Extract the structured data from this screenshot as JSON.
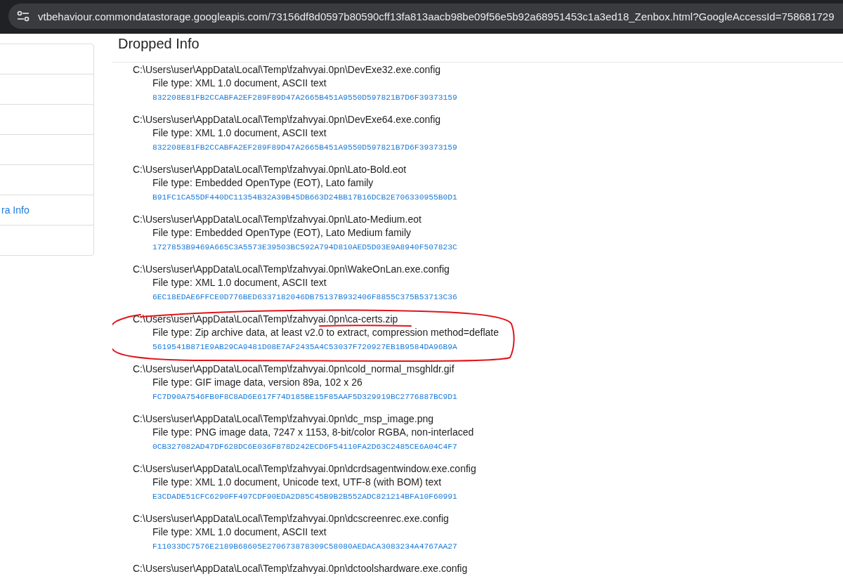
{
  "address_bar": {
    "url": "vtbehaviour.commondatastorage.googleapis.com/73156df8d0597b80590cff13fa813aacb98be09f56e5b92a68951453c1a3ed18_Zenbox.html?GoogleAccessId=758681729"
  },
  "sidebar": {
    "items": [
      {
        "kind": "blank"
      },
      {
        "kind": "blank"
      },
      {
        "kind": "blank"
      },
      {
        "kind": "blank"
      },
      {
        "kind": "blank"
      },
      {
        "kind": "link",
        "label": "ra Info"
      },
      {
        "kind": "blank"
      }
    ]
  },
  "section": {
    "title": "Dropped Info",
    "files": [
      {
        "path": "C:\\Users\\user\\AppData\\Local\\Temp\\fzahvyai.0pn\\DevExe32.exe.config",
        "file_type": "File type: XML 1.0 document, ASCII text",
        "hash": "832208E81FB2CCABFA2EF289F89D47A2665B451A9550D597821B7D6F39373159"
      },
      {
        "path": "C:\\Users\\user\\AppData\\Local\\Temp\\fzahvyai.0pn\\DevExe64.exe.config",
        "file_type": "File type: XML 1.0 document, ASCII text",
        "hash": "832208E81FB2CCABFA2EF289F89D47A2665B451A9550D597821B7D6F39373159"
      },
      {
        "path": "C:\\Users\\user\\AppData\\Local\\Temp\\fzahvyai.0pn\\Lato-Bold.eot",
        "file_type": "File type: Embedded OpenType (EOT), Lato family",
        "hash": "B91FC1CA55DF440DC11354B32A39B45DB663D24BB17B16DCB2E706330955B0D1"
      },
      {
        "path": "C:\\Users\\user\\AppData\\Local\\Temp\\fzahvyai.0pn\\Lato-Medium.eot",
        "file_type": "File type: Embedded OpenType (EOT), Lato Medium family",
        "hash": "1727853B9469A665C3A5573E39503BC592A794D810AED5D03E9A8940F507823C"
      },
      {
        "path": "C:\\Users\\user\\AppData\\Local\\Temp\\fzahvyai.0pn\\WakeOnLan.exe.config",
        "file_type": "File type: XML 1.0 document, ASCII text",
        "hash": "6EC18EDAE6FFCE0D776BED6337182046DB75137B932406F8855C375B53713C36"
      },
      {
        "path": "C:\\Users\\user\\AppData\\Local\\Temp\\fzahvyai.0pn\\ca-certs.zip",
        "file_type": "File type: Zip archive data, at least v2.0 to extract, compression method=deflate",
        "hash": "5619541B871E9AB29CA9481D08E7AF2435A4C53037F720927EB1B9584DA96B9A",
        "circled": true
      },
      {
        "path": "C:\\Users\\user\\AppData\\Local\\Temp\\fzahvyai.0pn\\cold_normal_msghldr.gif",
        "file_type": "File type: GIF image data, version 89a, 102 x 26",
        "hash": "FC7D90A7546FB0F8C8AD6E617F74D185BE15F85AAF5D329919BC2776887BC9D1"
      },
      {
        "path": "C:\\Users\\user\\AppData\\Local\\Temp\\fzahvyai.0pn\\dc_msp_image.png",
        "file_type": "File type: PNG image data, 7247 x 1153, 8-bit/color RGBA, non-interlaced",
        "hash": "0CB327082AD47DF628DC6E036F878D242ECD6F54110FA2D63C2485CE6A04C4F7"
      },
      {
        "path": "C:\\Users\\user\\AppData\\Local\\Temp\\fzahvyai.0pn\\dcrdsagentwindow.exe.config",
        "file_type": "File type: XML 1.0 document, Unicode text, UTF-8 (with BOM) text",
        "hash": "E3CDADE51CFC6290FF497CDF90EDA2D85C45B9B2B552ADC821214BFA10F60991"
      },
      {
        "path": "C:\\Users\\user\\AppData\\Local\\Temp\\fzahvyai.0pn\\dcscreenrec.exe.config",
        "file_type": "File type: XML 1.0 document, ASCII text",
        "hash": "F11033DC7576E2189B68605E270673878309C58080AEDACA3083234A4767AA27"
      },
      {
        "path": "C:\\Users\\user\\AppData\\Local\\Temp\\fzahvyai.0pn\\dctoolshardware.exe.config"
      }
    ]
  }
}
